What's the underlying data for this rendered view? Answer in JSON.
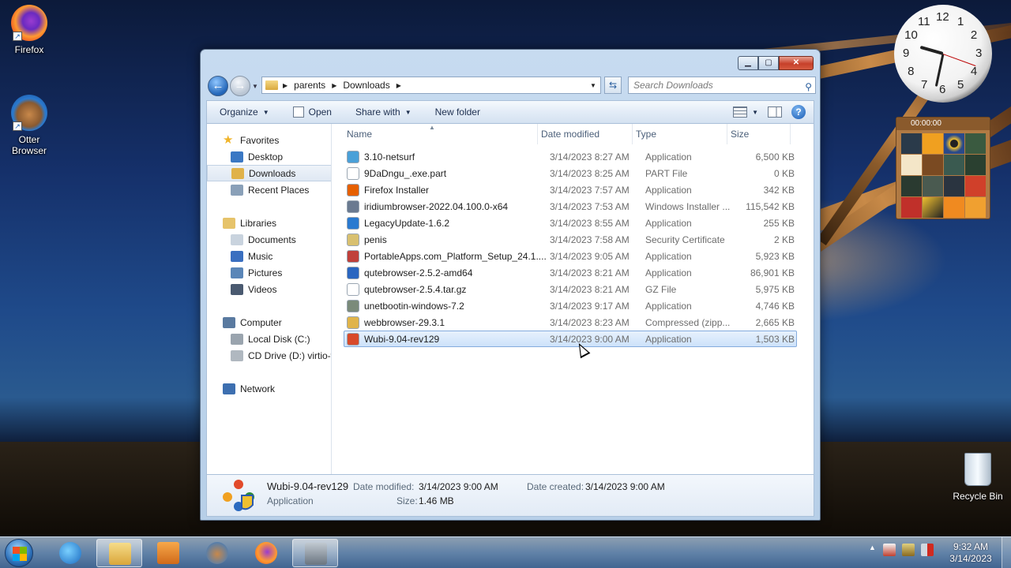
{
  "desktop": {
    "icons": [
      {
        "label": "Firefox"
      },
      {
        "label": "Otter\nBrowser"
      },
      {
        "label": "Recycle Bin"
      }
    ],
    "puzzle_timer": "00:00:00",
    "clock_numbers": [
      "12",
      "1",
      "2",
      "3",
      "4",
      "5",
      "6",
      "7",
      "8",
      "9",
      "10",
      "11"
    ]
  },
  "window": {
    "address": {
      "crumbs": [
        "parents",
        "Downloads"
      ]
    },
    "search_placeholder": "Search Downloads",
    "toolbar": {
      "organize": "Organize",
      "open": "Open",
      "share_with": "Share with",
      "new_folder": "New folder"
    },
    "nav": [
      {
        "label": "Favorites",
        "indent": 0,
        "icon": "star-icon",
        "color": "#f0b429"
      },
      {
        "label": "Desktop",
        "indent": 1,
        "icon": "desktop-icon",
        "color": "#3b78c4"
      },
      {
        "label": "Downloads",
        "indent": 1,
        "icon": "downloads-folder-icon",
        "color": "#e0b24a",
        "selected": true
      },
      {
        "label": "Recent Places",
        "indent": 1,
        "icon": "recent-places-icon",
        "color": "#8aa0b8"
      },
      {
        "label": "Libraries",
        "indent": 0,
        "icon": "libraries-icon",
        "color": "#e6c36a",
        "gap": true
      },
      {
        "label": "Documents",
        "indent": 1,
        "icon": "documents-icon",
        "color": "#c9d3de"
      },
      {
        "label": "Music",
        "indent": 1,
        "icon": "music-icon",
        "color": "#3a6fc0"
      },
      {
        "label": "Pictures",
        "indent": 1,
        "icon": "pictures-icon",
        "color": "#5a86b8"
      },
      {
        "label": "Videos",
        "indent": 1,
        "icon": "videos-icon",
        "color": "#4a5a70"
      },
      {
        "label": "Computer",
        "indent": 0,
        "icon": "computer-icon",
        "color": "#5a7aa0",
        "gap": true
      },
      {
        "label": "Local Disk (C:)",
        "indent": 1,
        "icon": "disk-icon",
        "color": "#9aa4ae"
      },
      {
        "label": "CD Drive (D:) virtio-w",
        "indent": 1,
        "icon": "cd-drive-icon",
        "color": "#b0b8c0"
      },
      {
        "label": "Network",
        "indent": 0,
        "icon": "network-icon",
        "color": "#3d6fb0",
        "gap": true
      }
    ],
    "columns": {
      "name": "Name",
      "date": "Date modified",
      "type": "Type",
      "size": "Size"
    },
    "files": [
      {
        "name": "3.10-netsurf",
        "date": "3/14/2023 8:27 AM",
        "type": "Application",
        "size": "6,500 KB",
        "icon": "netsurf-app-icon",
        "color": "#4aa0d8"
      },
      {
        "name": "9DaDngu_.exe.part",
        "date": "3/14/2023 8:25 AM",
        "type": "PART File",
        "size": "0 KB",
        "icon": "blank-file-icon",
        "color": "#ffffff"
      },
      {
        "name": "Firefox Installer",
        "date": "3/14/2023 7:57 AM",
        "type": "Application",
        "size": "342 KB",
        "icon": "firefox-installer-icon",
        "color": "#e66000"
      },
      {
        "name": "iridiumbrowser-2022.04.100.0-x64",
        "date": "3/14/2023 7:53 AM",
        "type": "Windows Installer ...",
        "size": "115,542 KB",
        "icon": "msi-installer-icon",
        "color": "#6a7a90"
      },
      {
        "name": "LegacyUpdate-1.6.2",
        "date": "3/14/2023 8:55 AM",
        "type": "Application",
        "size": "255 KB",
        "icon": "legacy-update-icon",
        "color": "#2a7ad0"
      },
      {
        "name": "penis",
        "date": "3/14/2023 7:58 AM",
        "type": "Security Certificate",
        "size": "2 KB",
        "icon": "certificate-icon",
        "color": "#d8c070"
      },
      {
        "name": "PortableApps.com_Platform_Setup_24.1....",
        "date": "3/14/2023 9:05 AM",
        "type": "Application",
        "size": "5,923 KB",
        "icon": "portableapps-icon",
        "color": "#c0403a"
      },
      {
        "name": "qutebrowser-2.5.2-amd64",
        "date": "3/14/2023 8:21 AM",
        "type": "Application",
        "size": "86,901 KB",
        "icon": "qutebrowser-icon",
        "color": "#2a66c0"
      },
      {
        "name": "qutebrowser-2.5.4.tar.gz",
        "date": "3/14/2023 8:21 AM",
        "type": "GZ File",
        "size": "5,975 KB",
        "icon": "blank-file-icon",
        "color": "#ffffff"
      },
      {
        "name": "unetbootin-windows-7.2",
        "date": "3/14/2023 9:17 AM",
        "type": "Application",
        "size": "4,746 KB",
        "icon": "unetbootin-icon",
        "color": "#7a8a7a"
      },
      {
        "name": "webbrowser-29.3.1",
        "date": "3/14/2023 8:23 AM",
        "type": "Compressed (zipp...",
        "size": "2,665 KB",
        "icon": "zip-folder-icon",
        "color": "#e0b44a"
      },
      {
        "name": "Wubi-9.04-rev129",
        "date": "3/14/2023 9:00 AM",
        "type": "Application",
        "size": "1,503 KB",
        "icon": "wubi-icon",
        "color": "#d84a2a",
        "selected": true
      }
    ],
    "details": {
      "name": "Wubi-9.04-rev129",
      "type": "Application",
      "modified_label": "Date modified:",
      "modified": "3/14/2023 9:00 AM",
      "created_label": "Date created:",
      "created": "3/14/2023 9:00 AM",
      "size_label": "Size:",
      "size": "1.46 MB"
    }
  },
  "taskbar": {
    "apps": [
      "internet-explorer-icon",
      "windows-explorer-icon",
      "media-player-icon",
      "otter-browser-icon",
      "firefox-icon",
      "unetbootin-icon"
    ],
    "time": "9:32 AM",
    "date": "3/14/2023"
  }
}
